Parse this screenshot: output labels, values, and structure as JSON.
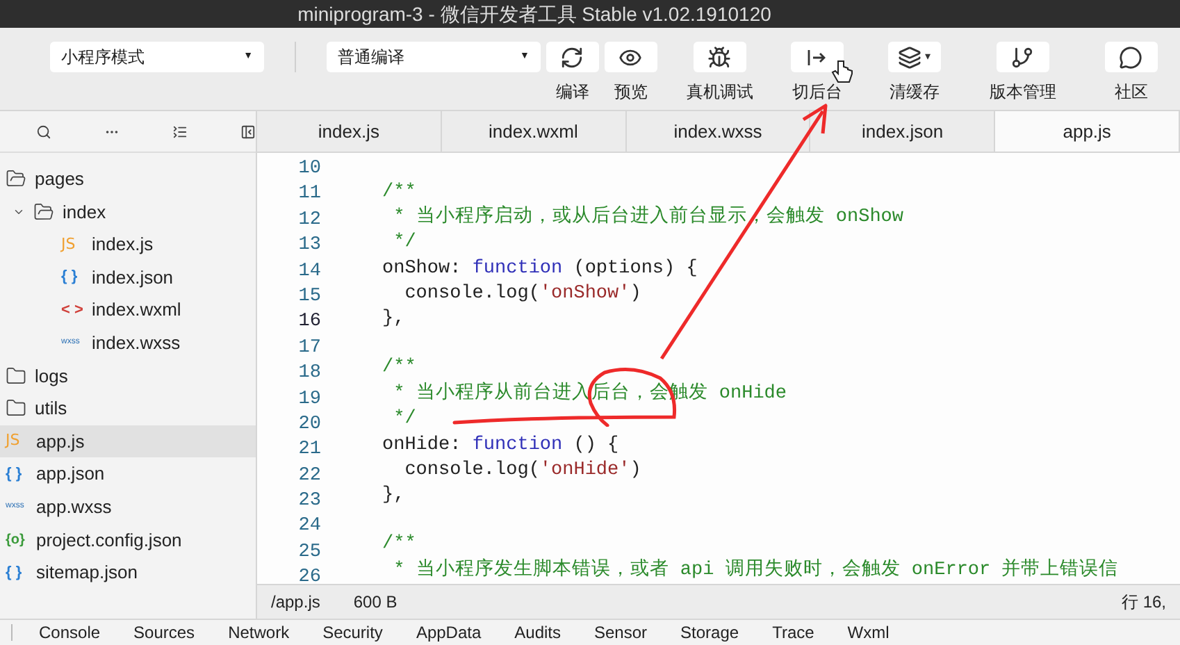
{
  "window": {
    "title": "miniprogram-3 - 微信开发者工具 Stable v1.02.1910120"
  },
  "toolbar": {
    "mode_select": {
      "value": "小程序模式",
      "caret": "▼"
    },
    "compile_select": {
      "value": "普通编译",
      "caret": "▼"
    },
    "buttons": [
      {
        "kind": "refresh",
        "label": "编译"
      },
      {
        "kind": "eye",
        "label": "预览"
      },
      {
        "kind": "bug",
        "label": "真机调试"
      },
      {
        "kind": "switch",
        "label": "切后台"
      },
      {
        "kind": "layers",
        "label": "清缓存",
        "caret": "▾"
      },
      {
        "kind": "branch",
        "label": "版本管理"
      },
      {
        "kind": "chat",
        "label": "社区"
      }
    ]
  },
  "editor_tabs": [
    {
      "label": "index.js",
      "selected": false
    },
    {
      "label": "index.wxml",
      "selected": false
    },
    {
      "label": "index.wxss",
      "selected": false
    },
    {
      "label": "index.json",
      "selected": false
    },
    {
      "label": "app.js",
      "selected": true
    }
  ],
  "file_tree": [
    {
      "kind": "folder",
      "name": "pages",
      "expanded": true,
      "selected": false,
      "children": [
        {
          "kind": "folder",
          "name": "index",
          "expanded": true,
          "selected": false,
          "children": [
            {
              "kind": "js",
              "icon": "JS",
              "name": "index.js",
              "selected": false
            },
            {
              "kind": "json",
              "icon": "{ }",
              "name": "index.json",
              "selected": false
            },
            {
              "kind": "wxml",
              "icon": "< >",
              "name": "index.wxml",
              "selected": false
            },
            {
              "kind": "wxss",
              "icon": "wxss",
              "name": "index.wxss",
              "selected": false
            }
          ]
        }
      ]
    },
    {
      "kind": "folder",
      "name": "logs",
      "expanded": false,
      "selected": false
    },
    {
      "kind": "folder",
      "name": "utils",
      "expanded": false,
      "selected": false
    },
    {
      "kind": "js",
      "icon": "JS",
      "name": "app.js",
      "selected": true
    },
    {
      "kind": "json",
      "icon": "{ }",
      "name": "app.json",
      "selected": false
    },
    {
      "kind": "wxss",
      "icon": "wxss",
      "name": "app.wxss",
      "selected": false
    },
    {
      "kind": "config",
      "icon": "{o}",
      "name": "project.config.json",
      "selected": false
    },
    {
      "kind": "json",
      "icon": "{ }",
      "name": "sitemap.json",
      "selected": false
    }
  ],
  "code": [
    {
      "number": "10",
      "current": false
    },
    {
      "number": "11",
      "current": false,
      "tokens": [
        {
          "kind": "comment",
          "text": "/**"
        }
      ]
    },
    {
      "number": "12",
      "current": false,
      "tokens": [
        {
          "kind": "comment",
          "text": " * 当小程序启动，或从后台进入前台显示，会触发 onShow"
        }
      ]
    },
    {
      "number": "13",
      "current": false,
      "tokens": [
        {
          "kind": "comment",
          "text": " */"
        }
      ]
    },
    {
      "number": "14",
      "current": false,
      "tokens": [
        {
          "kind": "plain",
          "text": "onShow: "
        },
        {
          "kind": "keyword",
          "text": "function"
        },
        {
          "kind": "plain",
          "text": " (options) {"
        }
      ]
    },
    {
      "number": "15",
      "current": false,
      "tokens": [
        {
          "kind": "plain",
          "text": "  console.log("
        },
        {
          "kind": "string",
          "text": "'onShow'"
        },
        {
          "kind": "plain",
          "text": ")"
        }
      ]
    },
    {
      "number": "16",
      "current": true,
      "tokens": [
        {
          "kind": "plain",
          "text": "},"
        }
      ]
    },
    {
      "number": "17",
      "current": false
    },
    {
      "number": "18",
      "current": false,
      "tokens": [
        {
          "kind": "comment",
          "text": "/**"
        }
      ]
    },
    {
      "number": "19",
      "current": false,
      "tokens": [
        {
          "kind": "comment",
          "text": " * 当小程序从前台进入后台，会触发 onHide"
        }
      ]
    },
    {
      "number": "20",
      "current": false,
      "tokens": [
        {
          "kind": "comment",
          "text": " */"
        }
      ]
    },
    {
      "number": "21",
      "current": false,
      "tokens": [
        {
          "kind": "plain",
          "text": "onHide: "
        },
        {
          "kind": "keyword",
          "text": "function"
        },
        {
          "kind": "plain",
          "text": " () {"
        }
      ]
    },
    {
      "number": "22",
      "current": false,
      "tokens": [
        {
          "kind": "plain",
          "text": "  console.log("
        },
        {
          "kind": "string",
          "text": "'onHide'"
        },
        {
          "kind": "plain",
          "text": ")"
        }
      ]
    },
    {
      "number": "23",
      "current": false,
      "tokens": [
        {
          "kind": "plain",
          "text": "},"
        }
      ]
    },
    {
      "number": "24",
      "current": false
    },
    {
      "number": "25",
      "current": false,
      "tokens": [
        {
          "kind": "comment",
          "text": "/**"
        }
      ]
    },
    {
      "number": "26",
      "current": false,
      "tokens": [
        {
          "kind": "comment",
          "text": " * 当小程序发生脚本错误，或者 api 调用失败时，会触发 onError 并带上错误信"
        }
      ]
    }
  ],
  "status_bar": {
    "path": "/app.js",
    "size": "600 B",
    "position": "行 16,"
  },
  "devtools_tabs": [
    "Console",
    "Sources",
    "Network",
    "Security",
    "AppData",
    "Audits",
    "Sensor",
    "Storage",
    "Trace",
    "Wxml"
  ]
}
